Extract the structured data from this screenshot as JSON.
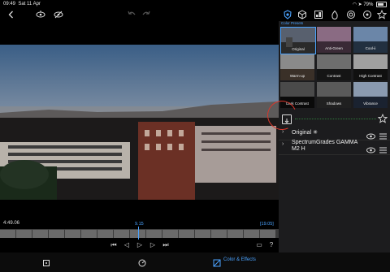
{
  "status": {
    "time": "09:49",
    "date": "Sat 11 Apr",
    "battery": "79%"
  },
  "timeline": {
    "current": "4:49.06",
    "playhead": "9.15",
    "duration": "[19.05]"
  },
  "color_presets": {
    "title": "Color Presets",
    "items": [
      "Original",
      "Anti-Green",
      "Cool-ii",
      "Warm-up",
      "Contrast",
      "High Contrast",
      "Dark Contrast",
      "Shadows",
      "Vibrance"
    ],
    "selected": "Original"
  },
  "layers": [
    {
      "name": "Original ✳"
    },
    {
      "name": "SpectrumGrades GAMMA M2 H"
    }
  ],
  "bottom": {
    "color_effects_label": "Color & Effects"
  },
  "colors": {
    "accent": "#4ba3ff",
    "annotation": "#d9362b"
  }
}
